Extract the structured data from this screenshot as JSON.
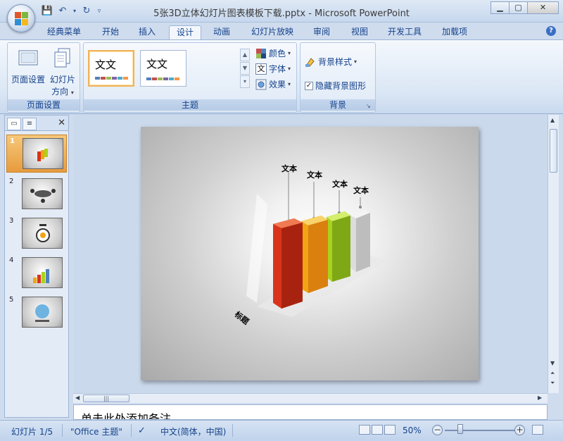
{
  "window": {
    "title": "5张3D立体幻灯片图表模板下载.pptx - Microsoft PowerPoint",
    "controls": [
      "minimize",
      "maximize",
      "close"
    ]
  },
  "quick_access": [
    "save-icon",
    "undo-icon",
    "redo-icon",
    "customize-icon"
  ],
  "tabs": [
    {
      "label": "经典菜单",
      "active": false
    },
    {
      "label": "开始",
      "active": false
    },
    {
      "label": "插入",
      "active": false
    },
    {
      "label": "设计",
      "active": true
    },
    {
      "label": "动画",
      "active": false
    },
    {
      "label": "幻灯片放映",
      "active": false
    },
    {
      "label": "审阅",
      "active": false
    },
    {
      "label": "视图",
      "active": false
    },
    {
      "label": "开发工具",
      "active": false
    },
    {
      "label": "加载项",
      "active": false
    }
  ],
  "ribbon": {
    "page_setup": {
      "group_label": "页面设置",
      "page_setup_btn": "页面设置",
      "orientation_btn_line1": "幻灯片",
      "orientation_btn_line2": "方向"
    },
    "themes": {
      "group_label": "主题",
      "theme1_text": "文文",
      "theme2_text": "文文",
      "colors_label": "颜色",
      "fonts_label": "字体",
      "effects_label": "效果",
      "fonts_icon_text": "文"
    },
    "background": {
      "group_label": "背景",
      "styles_label": "背景样式",
      "hide_graphics_label": "隐藏背景图形",
      "hide_graphics_checked": true
    }
  },
  "slides_pane": {
    "slides": [
      {
        "number": "1",
        "selected": true
      },
      {
        "number": "2",
        "selected": false
      },
      {
        "number": "3",
        "selected": false
      },
      {
        "number": "4",
        "selected": false
      },
      {
        "number": "5",
        "selected": false
      }
    ]
  },
  "slide": {
    "labels": [
      "文本",
      "文本",
      "文本",
      "文本"
    ],
    "axis_title": "标题",
    "bar_colors": [
      "#d9341b",
      "#f2a414",
      "#a9d21e",
      "#e4e4e4"
    ]
  },
  "notes": {
    "placeholder": "单击此处添加备注"
  },
  "status": {
    "slide_indicator": "幻灯片 1/5",
    "theme": "\"Office 主题\"",
    "language": "中文(简体，中国)",
    "zoom": "50%",
    "zoom_level_percent": 50
  }
}
